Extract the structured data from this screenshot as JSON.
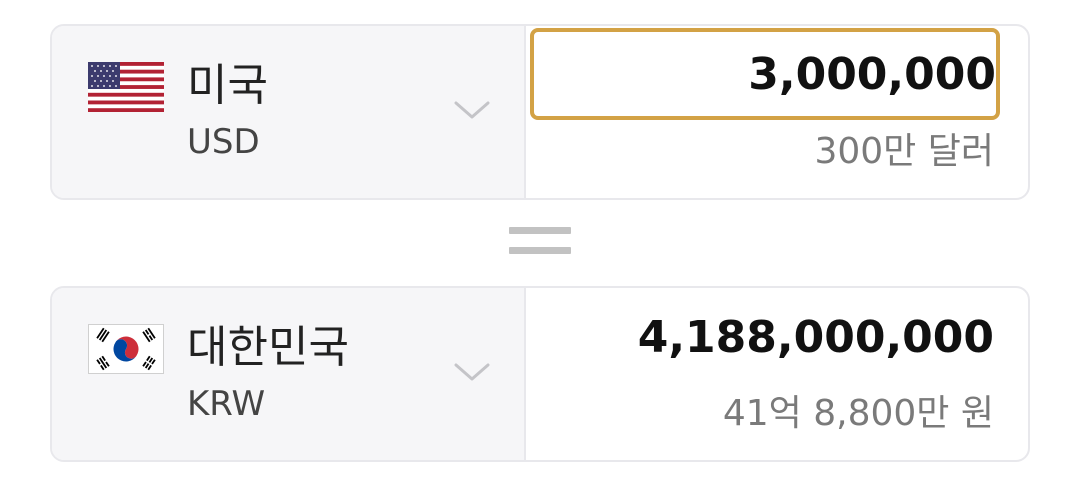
{
  "from_currency": {
    "country": "미국",
    "code": "USD",
    "flag_icon": "us-flag-icon",
    "amount": "3,000,000",
    "amount_korean": "300만 달러"
  },
  "to_currency": {
    "country": "대한민국",
    "code": "KRW",
    "flag_icon": "kr-flag-icon",
    "amount": "4,188,000,000",
    "amount_korean": "41억 8,800만 원"
  },
  "colors": {
    "input_focus_border": "#d3a245",
    "selector_background": "#f6f6f8",
    "border": "#e8e8ec",
    "secondary_text": "#7a7a7a",
    "equals_sign": "#c2c2c2"
  }
}
